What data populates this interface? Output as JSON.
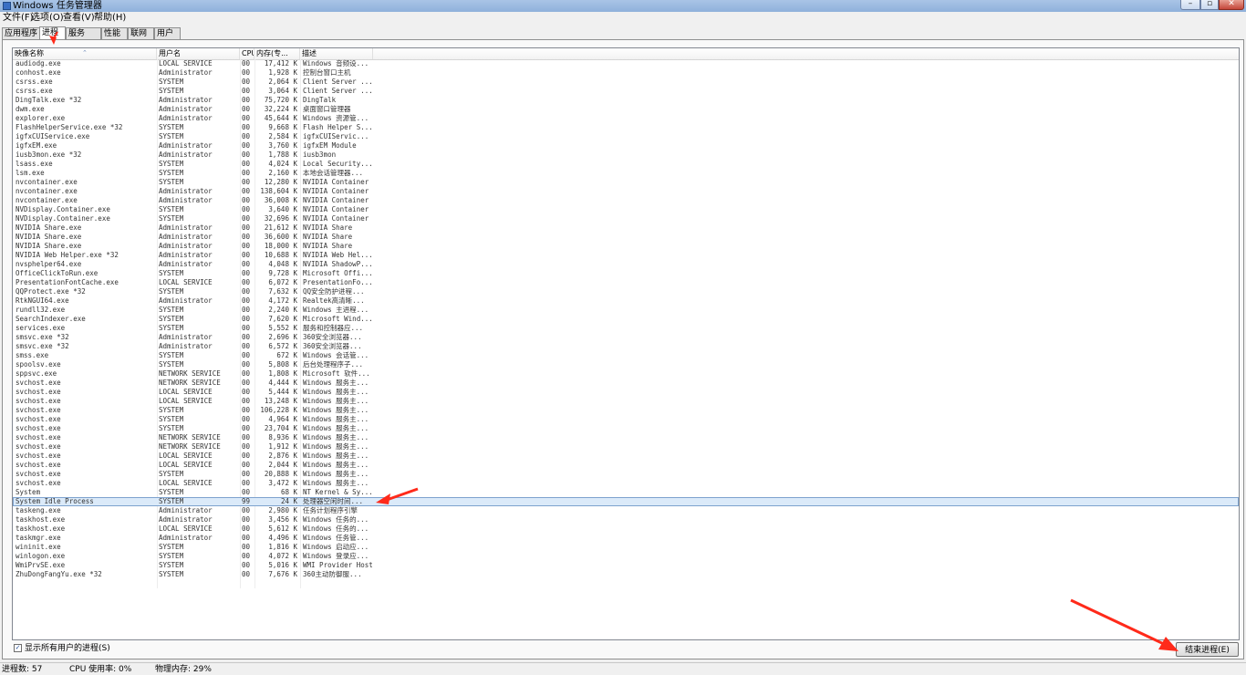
{
  "window": {
    "title": "Windows 任务管理器",
    "minimize": "–",
    "maximize": "▫",
    "close": "✕"
  },
  "menu": [
    "文件(F)",
    "选项(O)",
    "查看(V)",
    "帮助(H)"
  ],
  "tabs": [
    "应用程序",
    "进程",
    "服务",
    "性能",
    "联网",
    "用户"
  ],
  "columns": {
    "name": "映像名称",
    "user": "用户名",
    "cpu": "CPU",
    "mem": "内存(专...",
    "desc": "描述"
  },
  "processes": [
    {
      "name": "audiodg.exe",
      "user": "LOCAL SERVICE",
      "cpu": "00",
      "mem": "17,412 K",
      "desc": "Windows 音频设..."
    },
    {
      "name": "conhost.exe",
      "user": "Administrator",
      "cpu": "00",
      "mem": "1,928 K",
      "desc": "控制台窗口主机"
    },
    {
      "name": "csrss.exe",
      "user": "SYSTEM",
      "cpu": "00",
      "mem": "2,064 K",
      "desc": "Client Server ..."
    },
    {
      "name": "csrss.exe",
      "user": "SYSTEM",
      "cpu": "00",
      "mem": "3,064 K",
      "desc": "Client Server ..."
    },
    {
      "name": "DingTalk.exe *32",
      "user": "Administrator",
      "cpu": "00",
      "mem": "75,720 K",
      "desc": "DingTalk"
    },
    {
      "name": "dwm.exe",
      "user": "Administrator",
      "cpu": "00",
      "mem": "32,224 K",
      "desc": "桌面窗口管理器"
    },
    {
      "name": "explorer.exe",
      "user": "Administrator",
      "cpu": "00",
      "mem": "45,644 K",
      "desc": "Windows 资源管..."
    },
    {
      "name": "FlashHelperService.exe *32",
      "user": "SYSTEM",
      "cpu": "00",
      "mem": "9,668 K",
      "desc": "Flash Helper S..."
    },
    {
      "name": "igfxCUIService.exe",
      "user": "SYSTEM",
      "cpu": "00",
      "mem": "2,584 K",
      "desc": "igfxCUIServic..."
    },
    {
      "name": "igfxEM.exe",
      "user": "Administrator",
      "cpu": "00",
      "mem": "3,760 K",
      "desc": "igfxEM Module"
    },
    {
      "name": "iusb3mon.exe *32",
      "user": "Administrator",
      "cpu": "00",
      "mem": "1,788 K",
      "desc": "iusb3mon"
    },
    {
      "name": "lsass.exe",
      "user": "SYSTEM",
      "cpu": "00",
      "mem": "4,024 K",
      "desc": "Local Security..."
    },
    {
      "name": "lsm.exe",
      "user": "SYSTEM",
      "cpu": "00",
      "mem": "2,160 K",
      "desc": "本地会话管理器..."
    },
    {
      "name": "nvcontainer.exe",
      "user": "SYSTEM",
      "cpu": "00",
      "mem": "12,280 K",
      "desc": "NVIDIA Container"
    },
    {
      "name": "nvcontainer.exe",
      "user": "Administrator",
      "cpu": "00",
      "mem": "138,604 K",
      "desc": "NVIDIA Container"
    },
    {
      "name": "nvcontainer.exe",
      "user": "Administrator",
      "cpu": "00",
      "mem": "36,008 K",
      "desc": "NVIDIA Container"
    },
    {
      "name": "NVDisplay.Container.exe",
      "user": "SYSTEM",
      "cpu": "00",
      "mem": "3,640 K",
      "desc": "NVIDIA Container"
    },
    {
      "name": "NVDisplay.Container.exe",
      "user": "SYSTEM",
      "cpu": "00",
      "mem": "32,696 K",
      "desc": "NVIDIA Container"
    },
    {
      "name": "NVIDIA Share.exe",
      "user": "Administrator",
      "cpu": "00",
      "mem": "21,612 K",
      "desc": "NVIDIA Share"
    },
    {
      "name": "NVIDIA Share.exe",
      "user": "Administrator",
      "cpu": "00",
      "mem": "36,600 K",
      "desc": "NVIDIA Share"
    },
    {
      "name": "NVIDIA Share.exe",
      "user": "Administrator",
      "cpu": "00",
      "mem": "18,000 K",
      "desc": "NVIDIA Share"
    },
    {
      "name": "NVIDIA Web Helper.exe *32",
      "user": "Administrator",
      "cpu": "00",
      "mem": "10,688 K",
      "desc": "NVIDIA Web Hel..."
    },
    {
      "name": "nvsphelper64.exe",
      "user": "Administrator",
      "cpu": "00",
      "mem": "4,048 K",
      "desc": "NVIDIA ShadowP..."
    },
    {
      "name": "OfficeClickToRun.exe",
      "user": "SYSTEM",
      "cpu": "00",
      "mem": "9,728 K",
      "desc": "Microsoft Offi..."
    },
    {
      "name": "PresentationFontCache.exe",
      "user": "LOCAL SERVICE",
      "cpu": "00",
      "mem": "6,072 K",
      "desc": "PresentationFo..."
    },
    {
      "name": "QQProtect.exe *32",
      "user": "SYSTEM",
      "cpu": "00",
      "mem": "7,632 K",
      "desc": "QQ安全防护进程..."
    },
    {
      "name": "RtkNGUI64.exe",
      "user": "Administrator",
      "cpu": "00",
      "mem": "4,172 K",
      "desc": "Realtek高清晰..."
    },
    {
      "name": "rundll32.exe",
      "user": "SYSTEM",
      "cpu": "00",
      "mem": "2,240 K",
      "desc": "Windows 主进程..."
    },
    {
      "name": "SearchIndexer.exe",
      "user": "SYSTEM",
      "cpu": "00",
      "mem": "7,620 K",
      "desc": "Microsoft Wind..."
    },
    {
      "name": "services.exe",
      "user": "SYSTEM",
      "cpu": "00",
      "mem": "5,552 K",
      "desc": "服务和控制器应..."
    },
    {
      "name": "smsvc.exe *32",
      "user": "Administrator",
      "cpu": "00",
      "mem": "2,696 K",
      "desc": "360安全浏览器..."
    },
    {
      "name": "smsvc.exe *32",
      "user": "Administrator",
      "cpu": "00",
      "mem": "6,572 K",
      "desc": "360安全浏览器..."
    },
    {
      "name": "smss.exe",
      "user": "SYSTEM",
      "cpu": "00",
      "mem": "672 K",
      "desc": "Windows 会话管..."
    },
    {
      "name": "spoolsv.exe",
      "user": "SYSTEM",
      "cpu": "00",
      "mem": "5,808 K",
      "desc": "后台处理程序子..."
    },
    {
      "name": "sppsvc.exe",
      "user": "NETWORK SERVICE",
      "cpu": "00",
      "mem": "1,808 K",
      "desc": "Microsoft 软件..."
    },
    {
      "name": "svchost.exe",
      "user": "NETWORK SERVICE",
      "cpu": "00",
      "mem": "4,444 K",
      "desc": "Windows 服务主..."
    },
    {
      "name": "svchost.exe",
      "user": "LOCAL SERVICE",
      "cpu": "00",
      "mem": "5,444 K",
      "desc": "Windows 服务主..."
    },
    {
      "name": "svchost.exe",
      "user": "LOCAL SERVICE",
      "cpu": "00",
      "mem": "13,248 K",
      "desc": "Windows 服务主..."
    },
    {
      "name": "svchost.exe",
      "user": "SYSTEM",
      "cpu": "00",
      "mem": "106,228 K",
      "desc": "Windows 服务主..."
    },
    {
      "name": "svchost.exe",
      "user": "SYSTEM",
      "cpu": "00",
      "mem": "4,964 K",
      "desc": "Windows 服务主..."
    },
    {
      "name": "svchost.exe",
      "user": "SYSTEM",
      "cpu": "00",
      "mem": "23,704 K",
      "desc": "Windows 服务主..."
    },
    {
      "name": "svchost.exe",
      "user": "NETWORK SERVICE",
      "cpu": "00",
      "mem": "8,936 K",
      "desc": "Windows 服务主..."
    },
    {
      "name": "svchost.exe",
      "user": "NETWORK SERVICE",
      "cpu": "00",
      "mem": "1,912 K",
      "desc": "Windows 服务主..."
    },
    {
      "name": "svchost.exe",
      "user": "LOCAL SERVICE",
      "cpu": "00",
      "mem": "2,876 K",
      "desc": "Windows 服务主..."
    },
    {
      "name": "svchost.exe",
      "user": "LOCAL SERVICE",
      "cpu": "00",
      "mem": "2,044 K",
      "desc": "Windows 服务主..."
    },
    {
      "name": "svchost.exe",
      "user": "SYSTEM",
      "cpu": "00",
      "mem": "20,888 K",
      "desc": "Windows 服务主..."
    },
    {
      "name": "svchost.exe",
      "user": "LOCAL SERVICE",
      "cpu": "00",
      "mem": "3,472 K",
      "desc": "Windows 服务主..."
    },
    {
      "name": "System",
      "user": "SYSTEM",
      "cpu": "00",
      "mem": "68 K",
      "desc": "NT Kernel & Sy..."
    },
    {
      "name": "System Idle Process",
      "user": "SYSTEM",
      "cpu": "99",
      "mem": "24 K",
      "desc": "处理器空闲时间...",
      "selected": true
    },
    {
      "name": "taskeng.exe",
      "user": "Administrator",
      "cpu": "00",
      "mem": "2,980 K",
      "desc": "任务计划程序引擎"
    },
    {
      "name": "taskhost.exe",
      "user": "Administrator",
      "cpu": "00",
      "mem": "3,456 K",
      "desc": "Windows 任务的..."
    },
    {
      "name": "taskhost.exe",
      "user": "LOCAL SERVICE",
      "cpu": "00",
      "mem": "5,612 K",
      "desc": "Windows 任务的..."
    },
    {
      "name": "taskmgr.exe",
      "user": "Administrator",
      "cpu": "00",
      "mem": "4,496 K",
      "desc": "Windows 任务管..."
    },
    {
      "name": "wininit.exe",
      "user": "SYSTEM",
      "cpu": "00",
      "mem": "1,816 K",
      "desc": "Windows 启动应..."
    },
    {
      "name": "winlogon.exe",
      "user": "SYSTEM",
      "cpu": "00",
      "mem": "4,072 K",
      "desc": "Windows 登录应..."
    },
    {
      "name": "WmiPrvSE.exe",
      "user": "SYSTEM",
      "cpu": "00",
      "mem": "5,016 K",
      "desc": "WMI Provider Host"
    },
    {
      "name": "ZhuDongFangYu.exe *32",
      "user": "SYSTEM",
      "cpu": "00",
      "mem": "7,676 K",
      "desc": "360主动防御服..."
    }
  ],
  "show_all_label": "显示所有用户的进程(S)",
  "end_process_label": "结束进程(E)",
  "status": {
    "processes": "进程数: 57",
    "cpu": "CPU 使用率: 0%",
    "memory": "物理内存: 29%"
  },
  "annotation_color": "#ff2a1a"
}
